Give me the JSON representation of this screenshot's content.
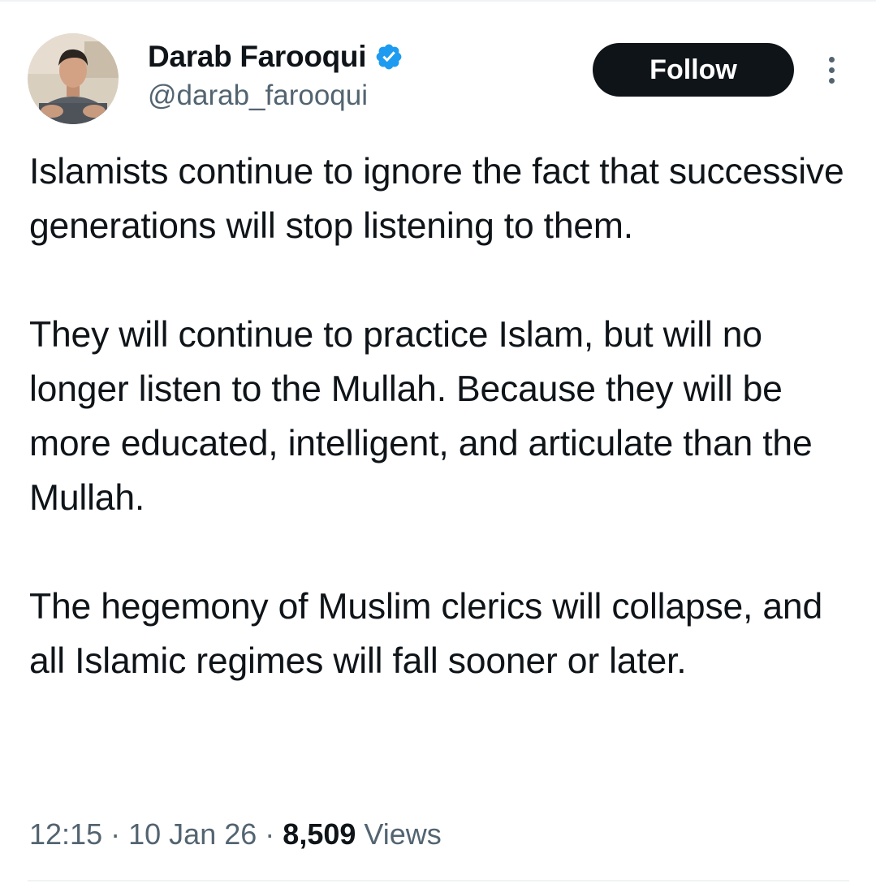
{
  "author": {
    "display_name": "Darab Farooqui",
    "handle": "@darab_farooqui",
    "verified": true,
    "verified_color": "#1d9bf0"
  },
  "actions": {
    "follow_label": "Follow",
    "more_icon": "more-vertical-icon"
  },
  "tweet": {
    "paragraphs": [
      "Islamists continue to ignore the fact that successive generations will stop listening to them.",
      "They will continue to practice Islam, but will no longer listen to the Mullah. Because they will be more educated, intelligent, and articulate than the Mullah.",
      "The hegemony of Muslim clerics will collapse, and all Islamic regimes will fall sooner or later."
    ]
  },
  "meta": {
    "time": "12:15",
    "separator": "·",
    "date": "10 Jan 26",
    "views_count": "8,509",
    "views_label": "Views"
  },
  "colors": {
    "text_primary": "#0f1419",
    "text_secondary": "#536471",
    "button_bg": "#0f1419",
    "divider": "#eff3f4"
  }
}
